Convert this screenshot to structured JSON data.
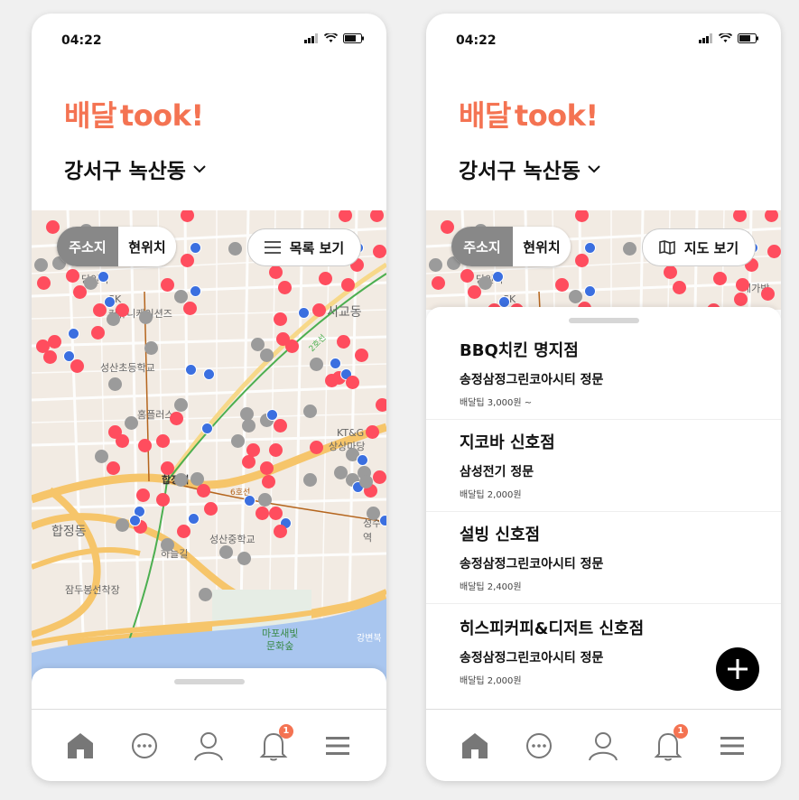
{
  "colors": {
    "brand": "#f47352",
    "marker_red": "#ff4d5e",
    "marker_gray": "#9b9b9b",
    "marker_blue": "#3b6fe0",
    "active_segment": "#888888"
  },
  "status": {
    "time": "04:22",
    "icons": [
      "signal-icon",
      "wifi-icon",
      "battery-icon"
    ]
  },
  "header": {
    "logo_korean": "배달",
    "logo_english": "took",
    "logo_mark": "!",
    "location": "강서구 녹산동"
  },
  "map_controls": {
    "segment_address": "주소지",
    "segment_current": "현위치"
  },
  "left": {
    "view_toggle": "목록 보기"
  },
  "right": {
    "view_toggle": "지도 보기"
  },
  "map_labels": [
    "SK",
    "커뮤니케이션즈",
    "서교동",
    "성산초등학교",
    "홈플러스",
    "KT&G",
    "상상마당",
    "합정역",
    "합정동",
    "성산중학교",
    "하늘길",
    "잠두봉선착장",
    "마포새빛",
    "문화숲",
    "6호선",
    "2호선",
    "강변북",
    "당인역",
    "성수역",
    "메가박",
    "SK"
  ],
  "nav": {
    "items": [
      "home-icon",
      "chat-icon",
      "profile-icon",
      "notification-icon",
      "menu-icon"
    ],
    "notification_count": "1"
  },
  "stores": [
    {
      "name": "BBQ치킨 명지점",
      "address": "송정삼정그린코아시티 정문",
      "fee": "배달팁 3,000원 ~"
    },
    {
      "name": "지코바 신호점",
      "address": "삼성전기 정문",
      "fee": "배달팁 2,000원"
    },
    {
      "name": "설빙 신호점",
      "address": "송정삼정그린코아시티 정문",
      "fee": "배달팁 2,400원"
    },
    {
      "name": "히스피커피&디저트 신호점",
      "address": "송정삼정그린코아시티 정문",
      "fee": "배달팁 2,000원"
    }
  ]
}
